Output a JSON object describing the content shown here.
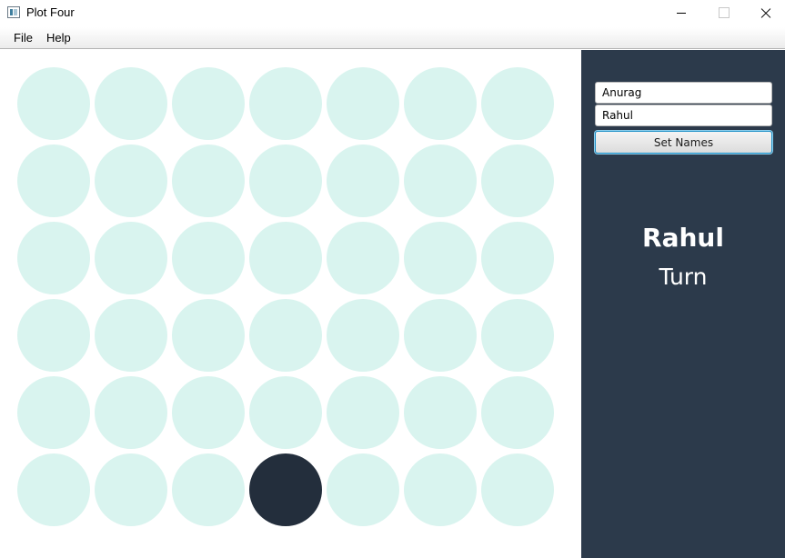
{
  "window": {
    "title": "Plot Four",
    "icon": "app-window-icon"
  },
  "menubar": {
    "items": [
      "File",
      "Help"
    ]
  },
  "board": {
    "rows": 6,
    "columns": 7,
    "empty_color": "#d9f4ef",
    "disc_color": "#232e3c",
    "discs": [
      {
        "row": 6,
        "column": 4
      }
    ]
  },
  "sidepanel": {
    "background_color": "#2c3a4b",
    "player_one_input": "Anurag",
    "player_two_input": "Rahul",
    "set_names_label": "Set Names",
    "current_player": "Rahul",
    "turn_label": "Turn"
  }
}
